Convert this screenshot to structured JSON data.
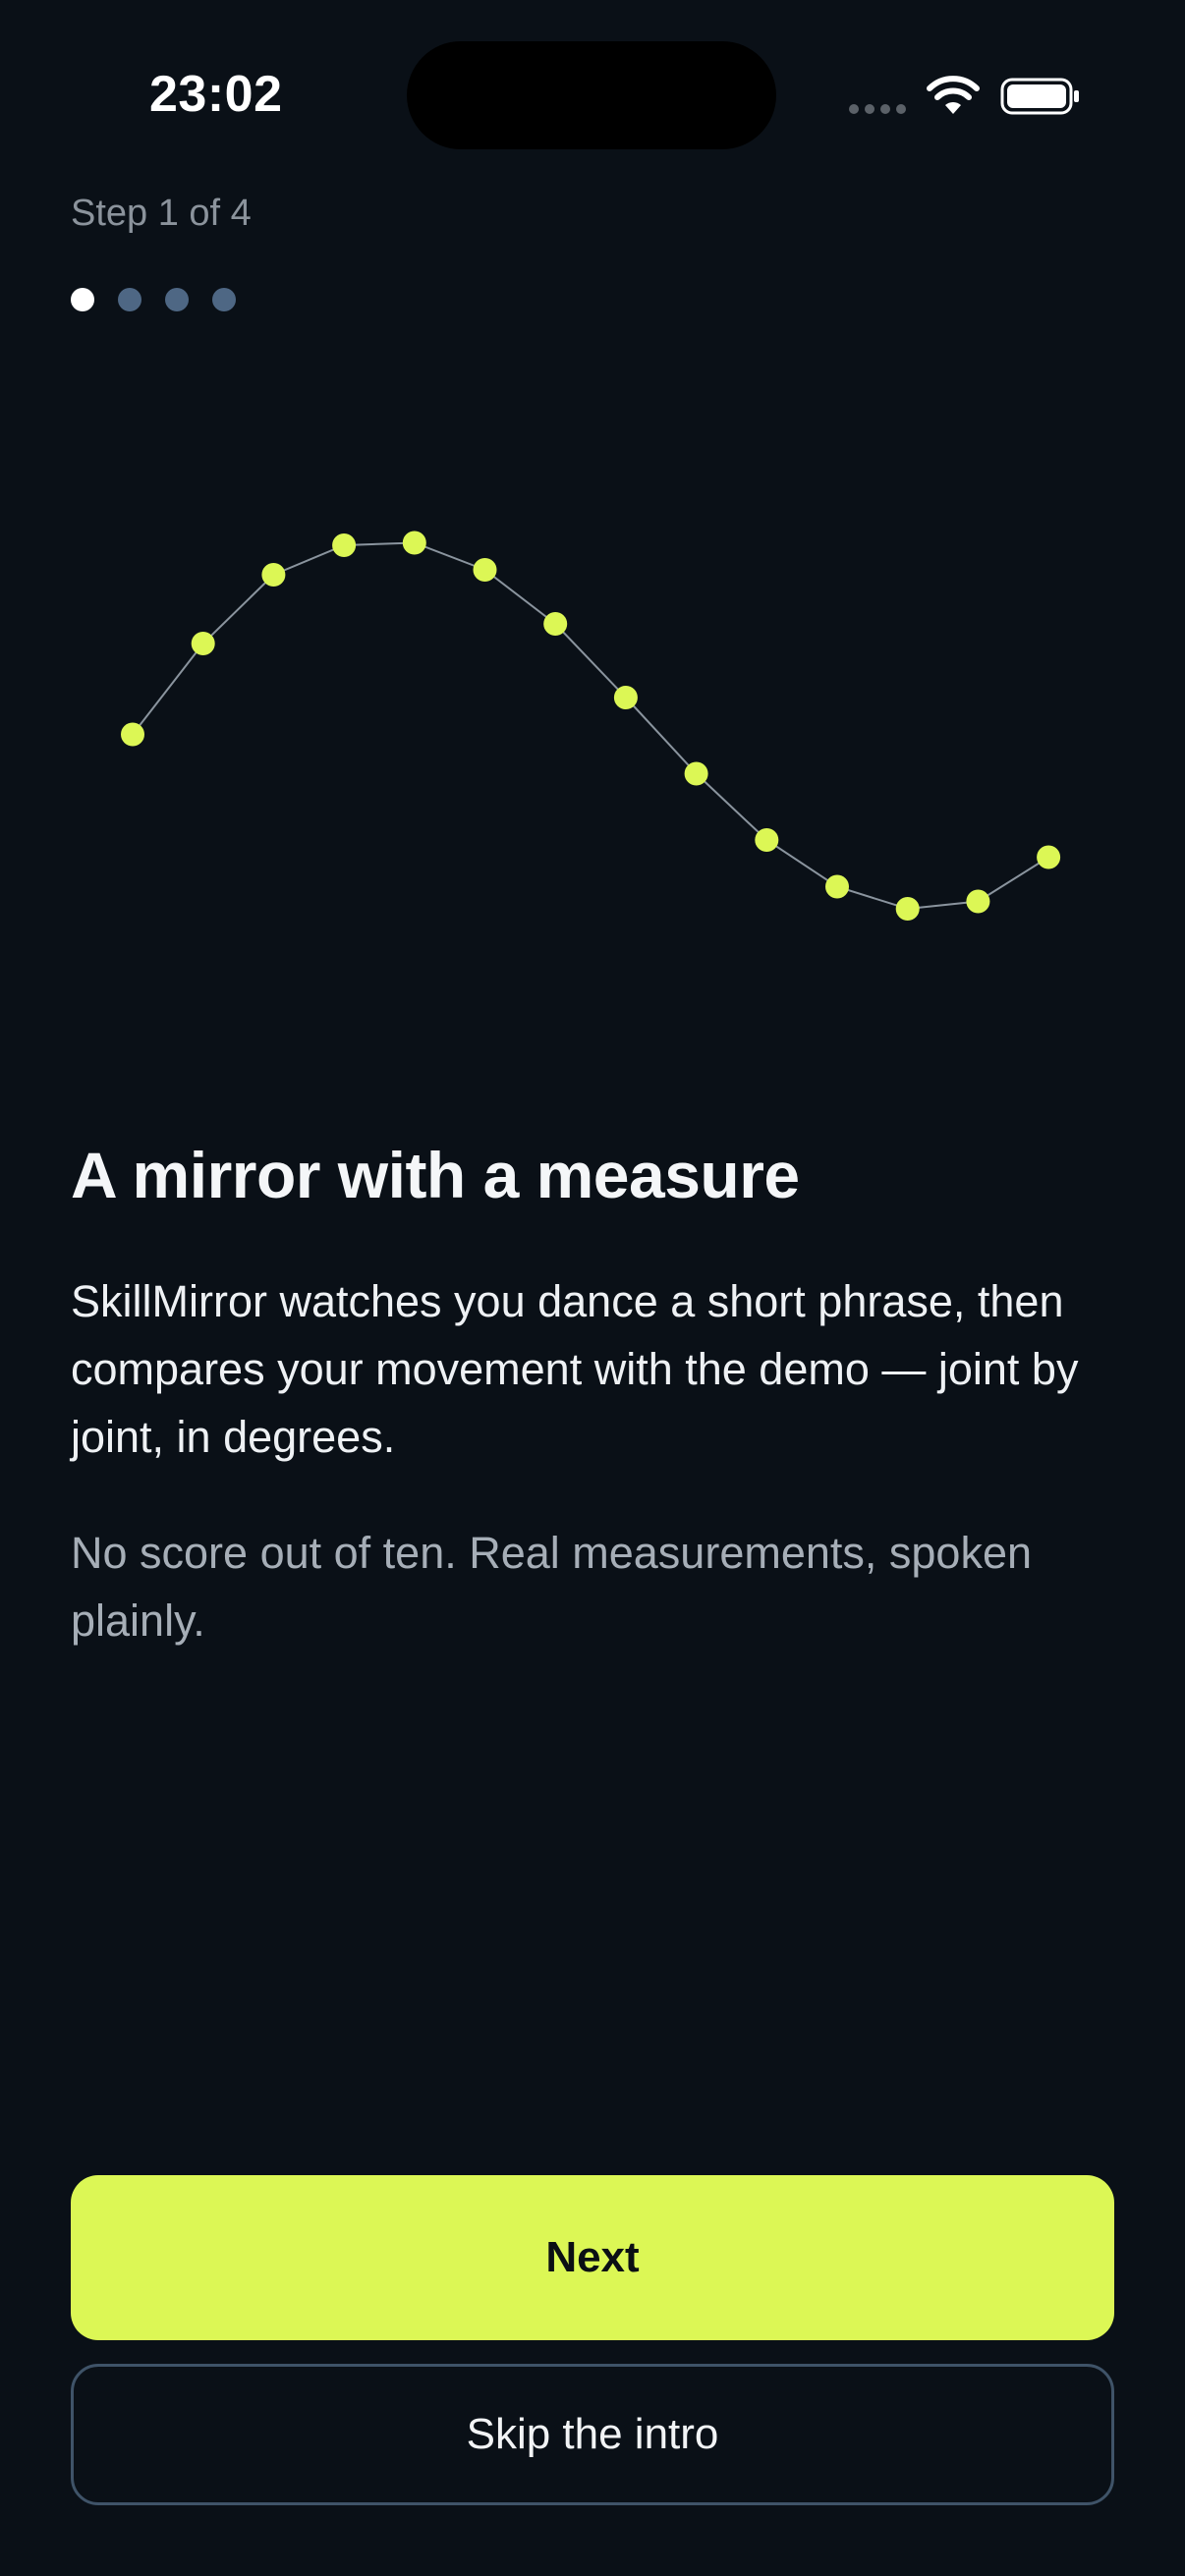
{
  "status_bar": {
    "time": "23:02",
    "icons": [
      "signal-dots-icon",
      "wifi-icon",
      "battery-icon"
    ]
  },
  "progress": {
    "label": "Step 1 of 4",
    "current_step": 1,
    "total_steps": 4
  },
  "illustration": {
    "type": "pose-trace",
    "point_color": "#dcf755",
    "line_color": "#8a949e",
    "points": [
      [
        0,
        0.23
      ],
      [
        1,
        0.6
      ],
      [
        2,
        0.88
      ],
      [
        3,
        1.0
      ],
      [
        4,
        1.01
      ],
      [
        5,
        0.9
      ],
      [
        6,
        0.68
      ],
      [
        7,
        0.38
      ],
      [
        8,
        0.07
      ],
      [
        9,
        -0.2
      ],
      [
        10,
        -0.39
      ],
      [
        11,
        -0.48
      ],
      [
        12,
        -0.45
      ],
      [
        13,
        -0.27
      ]
    ]
  },
  "content": {
    "title": "A mirror with a measure",
    "body": "SkillMirror watches you dance a short phrase, then compares your movement with the demo — joint by joint, in degrees.",
    "secondary": "No score out of ten. Real measurements, spoken plainly."
  },
  "actions": {
    "next_label": "Next",
    "skip_label": "Skip the intro"
  },
  "colors": {
    "background": "#0a1017",
    "accent": "#dcf755",
    "dot_inactive": "#4e6784",
    "dot_active": "#ffffff",
    "outline": "#3f5368"
  }
}
